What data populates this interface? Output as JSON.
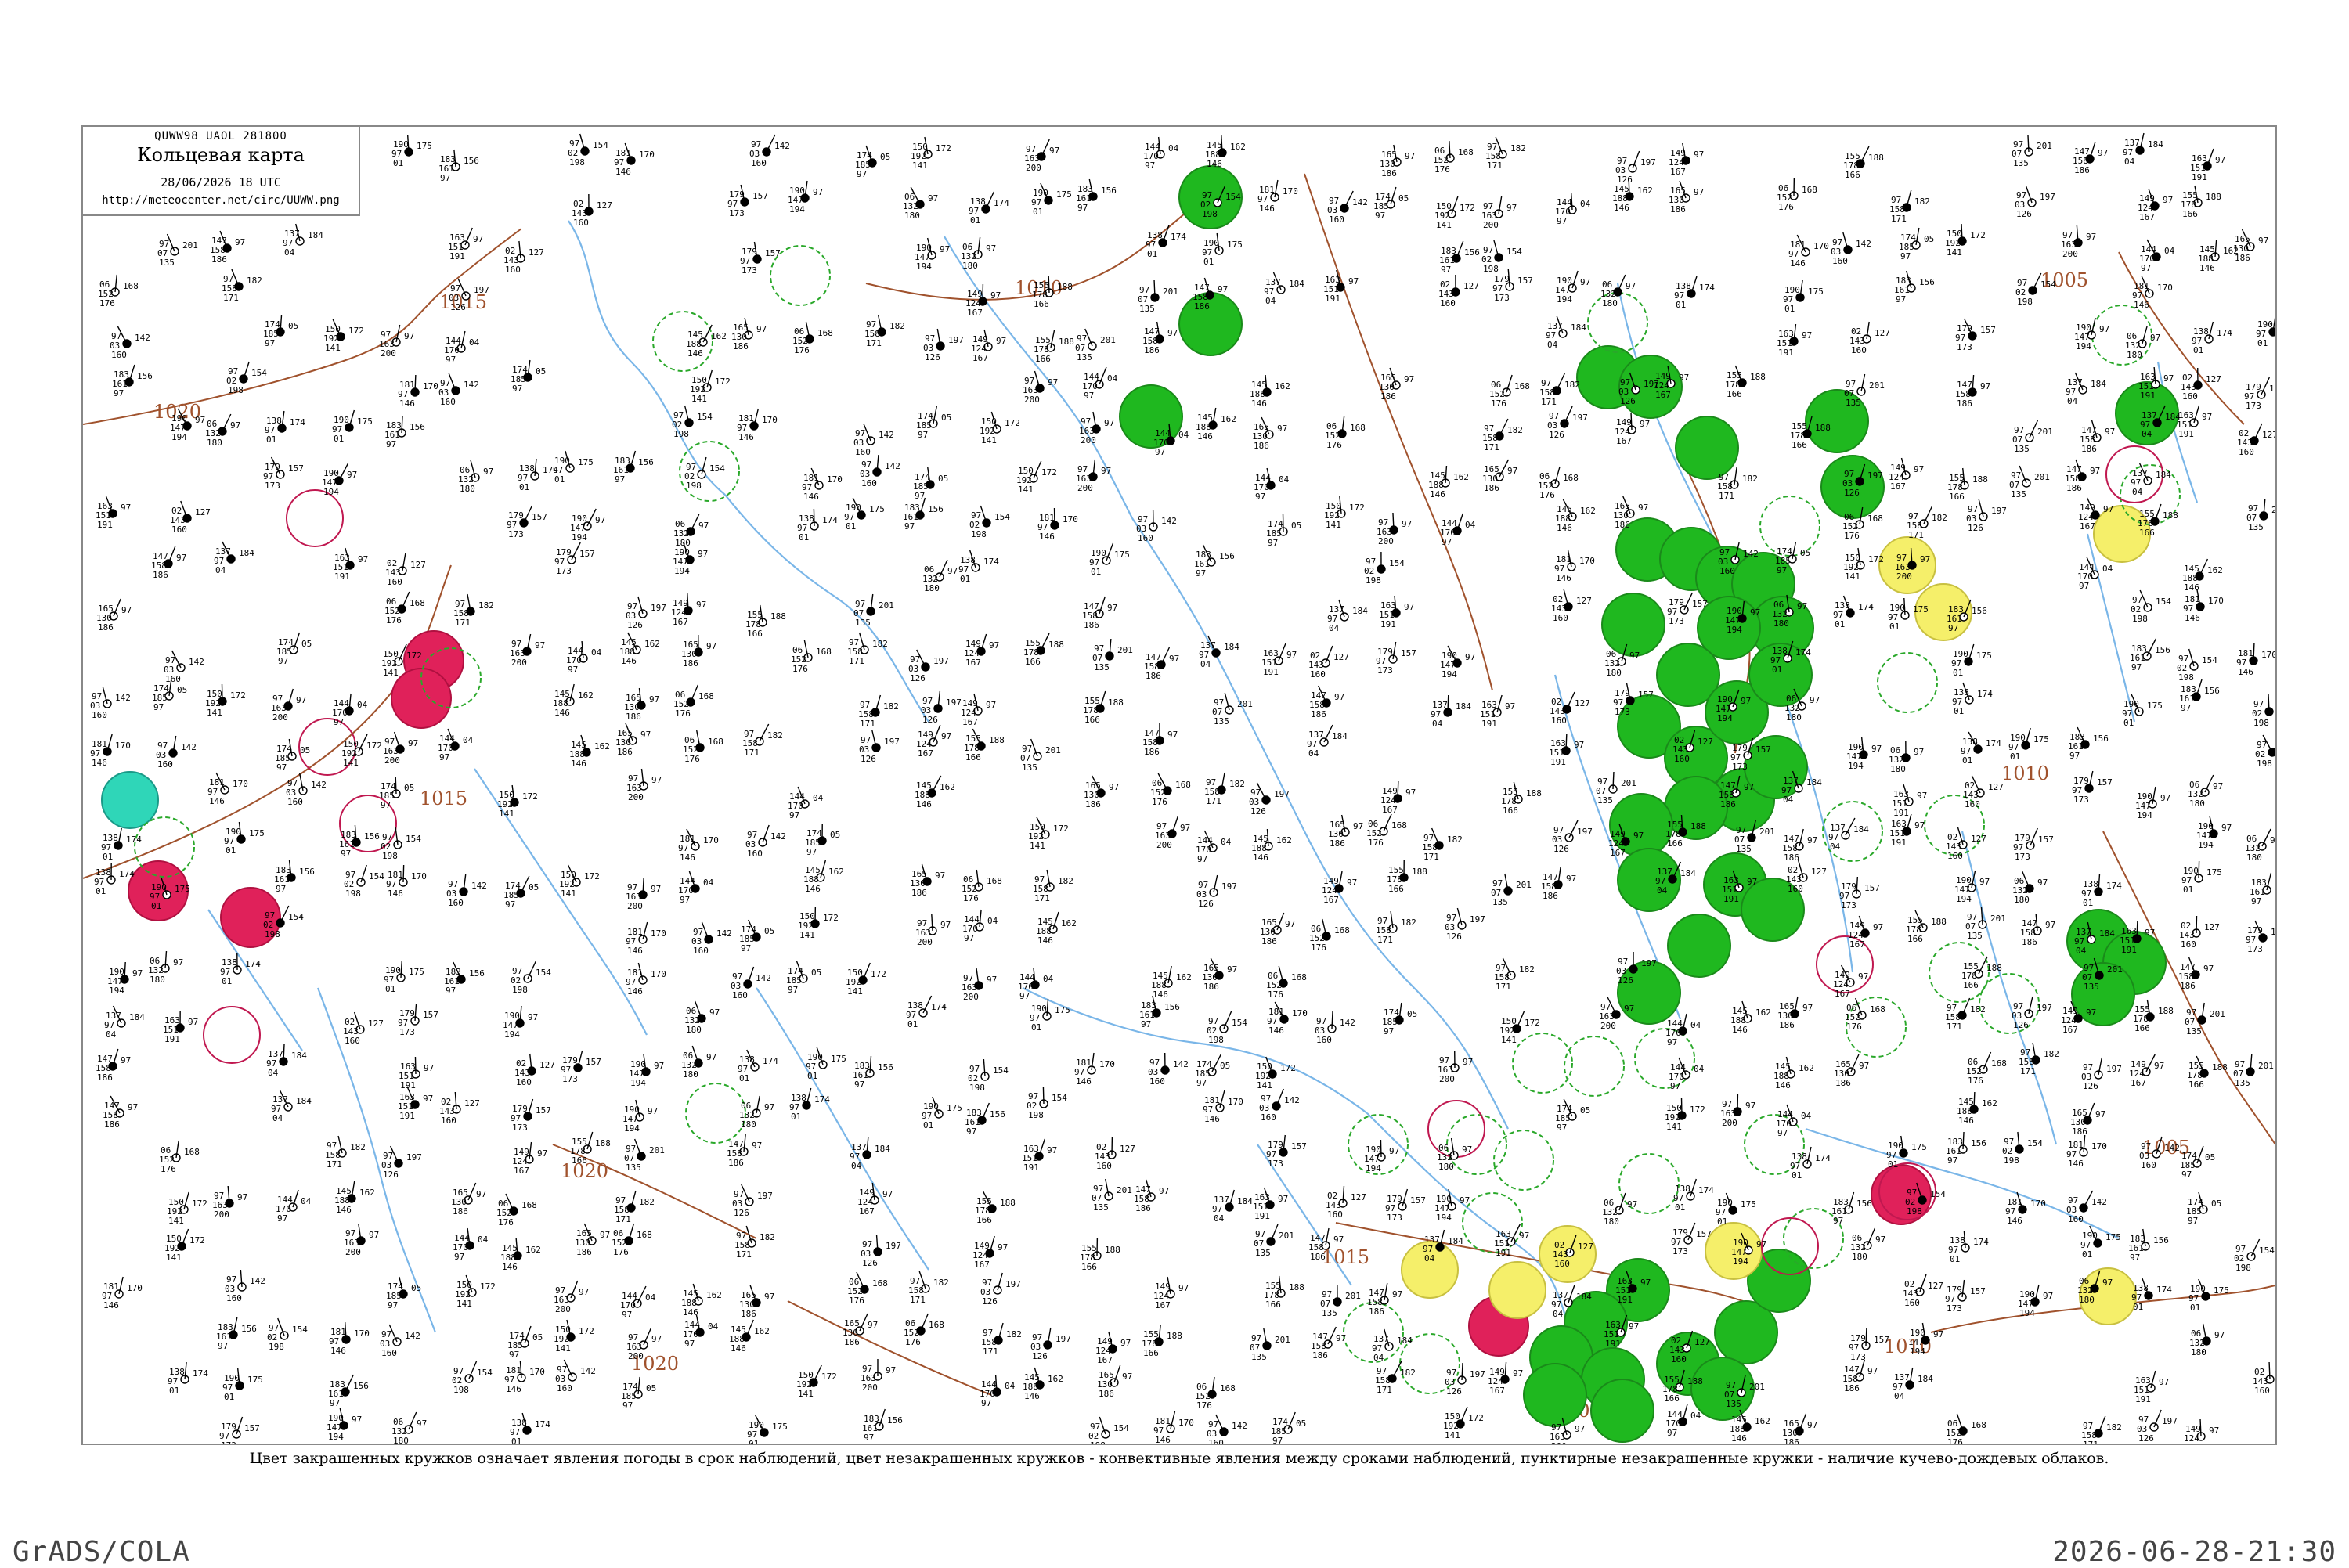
{
  "header": {
    "code": "QUWW98 UAOL 281800",
    "title": "Кольцевая карта",
    "date": "28/06/2026 18 UTC",
    "url": "http://meteocenter.net/circ/UUWW.png"
  },
  "isobar_labels": [
    "1010",
    "1015",
    "1020",
    "1005",
    "1015",
    "1020",
    "1015",
    "1010",
    "1010",
    "1015",
    "1005",
    "1020"
  ],
  "legend_caption": "Цвет закрашенных кружков означает явления погоды в срок наблюдений, цвет незакрашенных кружков - конвективные явления между сроками наблюдений, пунктирные незакрашенные кружки - наличие кучево-дождевых облаков.",
  "footer": {
    "left": "GrADS/COLA",
    "right": "2026-06-28-21:30"
  },
  "colors": {
    "green_fill": "#1fb81f",
    "red_fill": "#e0215a",
    "yellow_fill": "#f5ef6a",
    "cyan_fill": "#2fd6b8",
    "isobar": "#a0522d",
    "river": "#7ab6e8",
    "station_text": "#000000"
  },
  "station_values": [
    "190",
    "97",
    "01",
    "175",
    "183",
    "161",
    "97",
    "156",
    "97",
    "02",
    "198",
    "154",
    "181",
    "97",
    "146",
    "170",
    "97",
    "03",
    "160",
    "142",
    "174",
    "185",
    "97",
    "05",
    "150",
    "192",
    "141",
    "172",
    "97",
    "163",
    "200",
    "97",
    "144",
    "170",
    "97",
    "04",
    "145",
    "188",
    "146",
    "162",
    "165",
    "130",
    "186",
    "97",
    "06",
    "152",
    "176",
    "168",
    "97",
    "158",
    "171",
    "182",
    "97",
    "03",
    "126",
    "197",
    "149",
    "124",
    "167",
    "97",
    "155",
    "178",
    "166",
    "188",
    "97",
    "07",
    "135",
    "201",
    "147",
    "158",
    "186",
    "97",
    "137",
    "97",
    "04",
    "184",
    "163",
    "151",
    "191",
    "97",
    "02",
    "143",
    "160",
    "127",
    "179",
    "97",
    "173",
    "157",
    "190",
    "147",
    "194",
    "97",
    "06",
    "132",
    "180",
    "97",
    "138",
    "97",
    "01",
    "174"
  ]
}
